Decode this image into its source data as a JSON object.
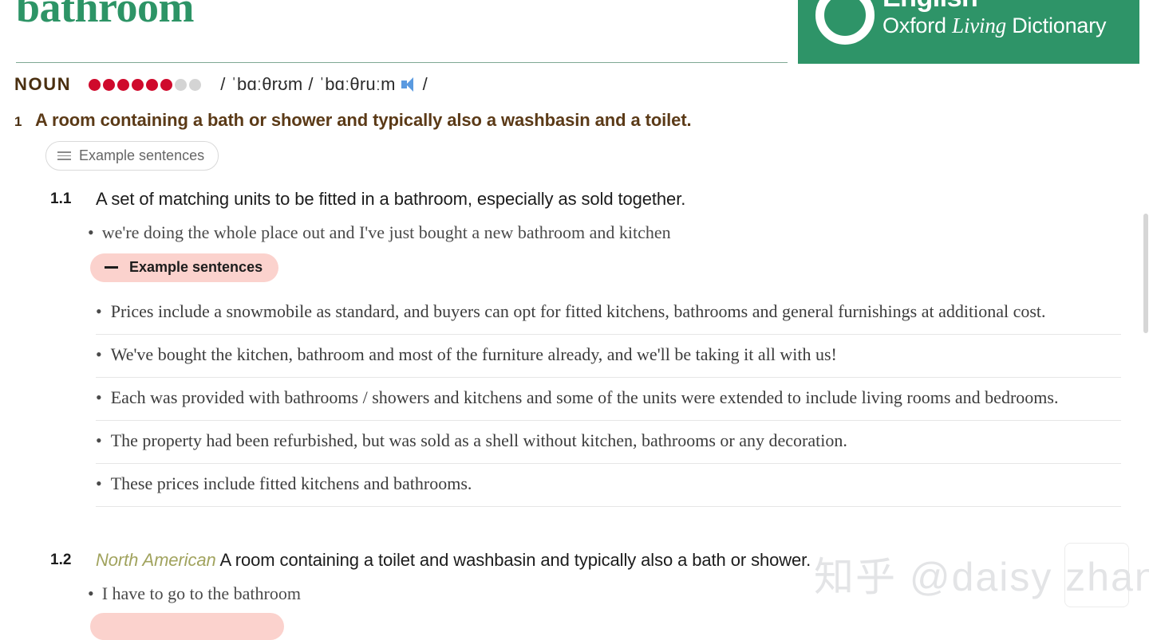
{
  "header": {
    "headword": "bathroom",
    "logo": {
      "circle_icon": "oxford-ring-icon",
      "primary": "English",
      "secondary_pre": "Oxford ",
      "secondary_italic": "Living",
      "secondary_post": " Dictionary"
    }
  },
  "pos_row": {
    "part_of_speech": "NOUN",
    "frequency_dots_filled": 6,
    "frequency_dots_empty": 2,
    "frequency_dot_color": "#cf0a2c",
    "frequency_dot_empty_color": "#d4d4d4",
    "pronunciation_open": "/",
    "pronunciation_british": "ˈbɑːθrʊm",
    "pronunciation_sep": "/",
    "pronunciation_american": "ˈbɑːθruːm",
    "speaker_icon": "speaker-icon",
    "pronunciation_close": "/"
  },
  "sense1": {
    "number": "1",
    "definition": "A room containing a bath or shower and typically also a washbasin and a toilet.",
    "button_label": "Example sentences",
    "button_icon": "hamburger-icon"
  },
  "sense1_1": {
    "number": "1.1",
    "definition": "A set of matching units to be fitted in a bathroom, especially as sold together.",
    "inline_example_bullet": "•",
    "inline_example": "we're doing the whole place out and I've just bought a new bathroom and kitchen",
    "pill_label": "Example sentences",
    "pill_dash": "—",
    "examples": [
      "Prices include a snowmobile as standard, and buyers can opt for fitted kitchens, bathrooms and general furnishings at additional cost.",
      "We've bought the kitchen, bathroom and most of the furniture already, and we'll be taking it all with us!",
      "Each was provided with bathrooms / showers and kitchens and some of the units were extended to include living rooms and bedrooms.",
      "The property had been refurbished, but was sold as a shell without kitchen, bathrooms or any decoration.",
      "These prices include fitted kitchens and bathrooms."
    ],
    "bullet": "•"
  },
  "sense1_2": {
    "number": "1.2",
    "region": "North American",
    "definition": "A room containing a toilet and washbasin and typically also a bath or shower.",
    "bullet": "•",
    "inline_example": "I have to go to the bathroom"
  },
  "watermark": {
    "text": "知乎 @daisy zhang"
  },
  "colors": {
    "brand_green": "#2e9468",
    "headword_green": "#2d9466",
    "definition_brown": "#5b3a17",
    "pos_brown": "#4a2f10",
    "pink_pill": "#fbd2cd",
    "region_olive": "#a1a35e"
  }
}
